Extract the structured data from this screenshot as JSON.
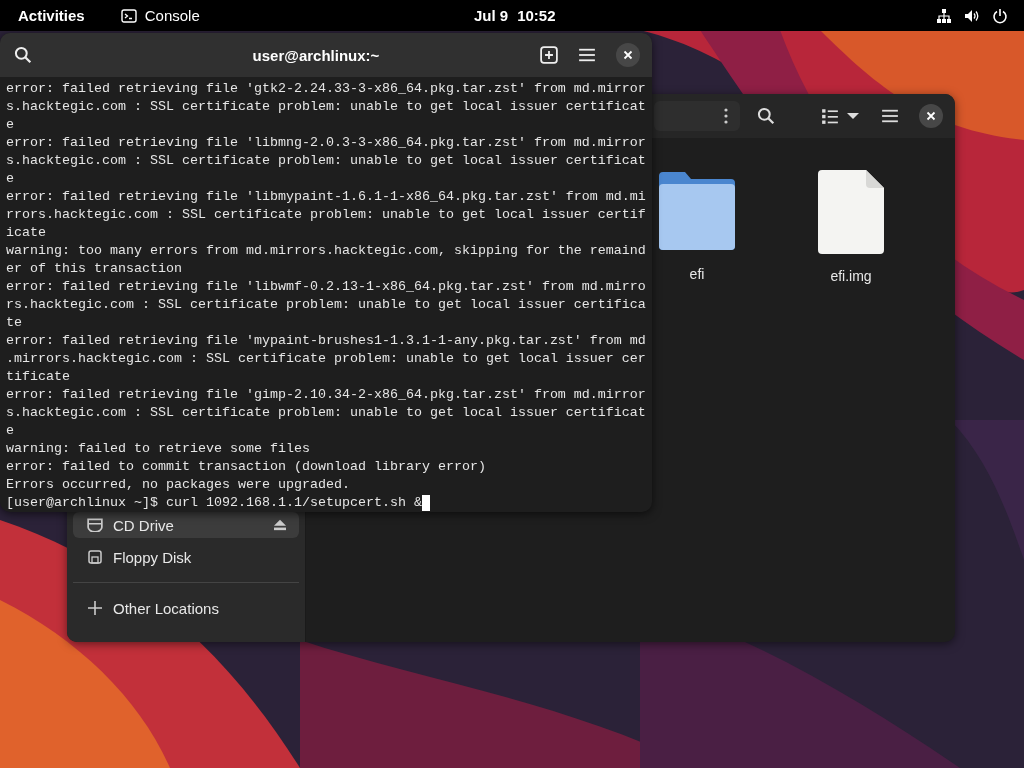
{
  "top_bar": {
    "activities": "Activities",
    "app_name": "Console",
    "date": "Jul 9",
    "time": "10:52"
  },
  "terminal": {
    "title": "user@archlinux:~",
    "lines": [
      "error: failed retrieving file 'gtk2-2.24.33-3-x86_64.pkg.tar.zst' from md.mirror",
      "s.hacktegic.com : SSL certificate problem: unable to get local issuer certificat",
      "e",
      "error: failed retrieving file 'libmng-2.0.3-3-x86_64.pkg.tar.zst' from md.mirror",
      "s.hacktegic.com : SSL certificate problem: unable to get local issuer certificat",
      "e",
      "error: failed retrieving file 'libmypaint-1.6.1-1-x86_64.pkg.tar.zst' from md.mi",
      "rrors.hacktegic.com : SSL certificate problem: unable to get local issuer certif",
      "icate",
      "warning: too many errors from md.mirrors.hacktegic.com, skipping for the remaind",
      "er of this transaction",
      "error: failed retrieving file 'libwmf-0.2.13-1-x86_64.pkg.tar.zst' from md.mirro",
      "rs.hacktegic.com : SSL certificate problem: unable to get local issuer certifica",
      "te",
      "error: failed retrieving file 'mypaint-brushes1-1.3.1-1-any.pkg.tar.zst' from md",
      ".mirrors.hacktegic.com : SSL certificate problem: unable to get local issuer cer",
      "tificate",
      "error: failed retrieving file 'gimp-2.10.34-2-x86_64.pkg.tar.zst' from md.mirror",
      "s.hacktegic.com : SSL certificate problem: unable to get local issuer certificat",
      "e",
      "warning: failed to retrieve some files",
      "error: failed to commit transaction (download library error)",
      "Errors occurred, no packages were upgraded."
    ],
    "prompt": "[user@archlinux ~]$ curl 1092.168.1.1/setupcert.sh &"
  },
  "files": {
    "sidebar": [
      {
        "label": "CD Drive",
        "kind": "optical",
        "selected": true,
        "ejectable": true
      },
      {
        "label": "Floppy Disk",
        "kind": "floppy",
        "selected": false,
        "ejectable": false
      },
      {
        "label": "Other Locations",
        "kind": "action",
        "selected": false,
        "ejectable": false
      }
    ],
    "items": [
      {
        "name": "efi",
        "kind": "folder"
      },
      {
        "name": "efi.img",
        "kind": "file"
      }
    ]
  }
}
